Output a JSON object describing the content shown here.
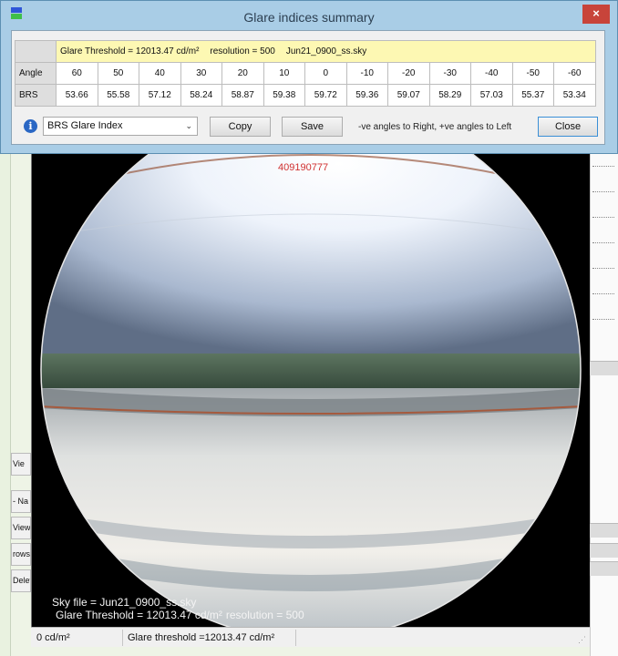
{
  "dialog": {
    "title": "Glare indices summary",
    "close_glyph": "×",
    "info": {
      "threshold": "Glare Threshold = 12013.47 cd/m²",
      "resolution": "resolution = 500",
      "sky_file": "Jun21_0900_ss.sky"
    },
    "table": {
      "angle_label": "Angle",
      "brs_label": "BRS",
      "angles": [
        "60",
        "50",
        "40",
        "30",
        "20",
        "10",
        "0",
        "-10",
        "-20",
        "-30",
        "-40",
        "-50",
        "-60"
      ],
      "brs": [
        "53.66",
        "55.58",
        "57.12",
        "58.24",
        "58.87",
        "59.38",
        "59.72",
        "59.36",
        "59.07",
        "58.29",
        "57.03",
        "55.37",
        "53.34"
      ]
    },
    "toolbar": {
      "index_select": "BRS Glare Index",
      "copy_label": "Copy",
      "save_label": "Save",
      "hint": "-ve angles to Right, +ve angles to Left",
      "close_label": "Close",
      "info_glyph": "i",
      "caret_glyph": "⌄"
    },
    "icon": "app-icon"
  },
  "viewport": {
    "code": "409190777",
    "sky_file_label": "Sky file = Jun21_0900_ss.sky",
    "threshold_label": "Glare Threshold = 12013.47 cd/m²",
    "resolution_label": "resolution = 500"
  },
  "statusbar": {
    "units": "0 cd/m²",
    "threshold": "Glare threshold =12013.47 cd/m²",
    "grip": "⋰"
  },
  "background": {
    "tabs": [
      "Vie",
      "- Na",
      "View",
      "rows",
      "Delet"
    ]
  },
  "colors": {
    "title_bar": "#a9cde6",
    "info_row": "#fdf8b3",
    "close_x": "#c8443a",
    "code_text": "#d03030"
  }
}
